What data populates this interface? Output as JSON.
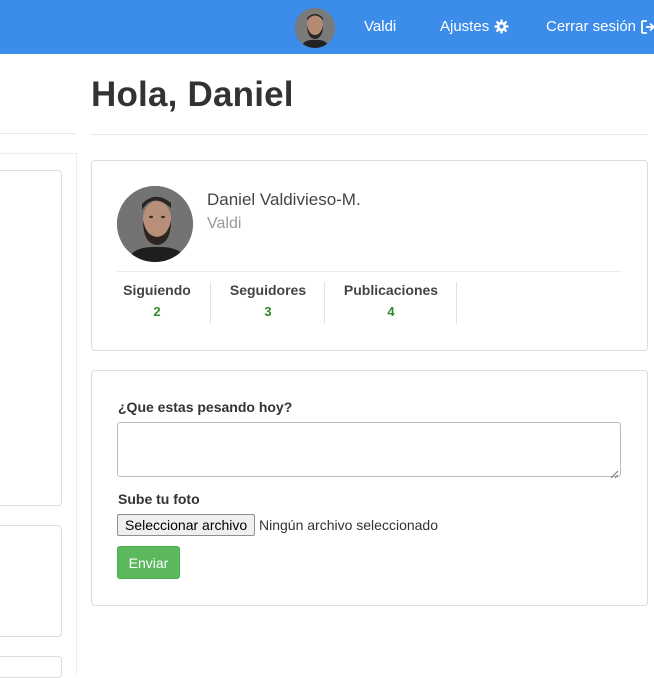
{
  "navbar": {
    "username": "Valdi",
    "settings_label": "Ajustes",
    "logout_label": "Cerrar sesión",
    "background": "#3c8cea",
    "icons": {
      "settings": "gear-icon",
      "logout": "sign-out-icon"
    }
  },
  "main": {
    "greeting": "Hola, Daniel"
  },
  "profile": {
    "full_name": "Daniel Valdivieso-M.",
    "username": "Valdi",
    "stats": [
      {
        "label": "Siguiendo",
        "value": "2"
      },
      {
        "label": "Seguidores",
        "value": "3"
      },
      {
        "label": "Publicaciones",
        "value": "4"
      }
    ],
    "stat_value_color": "#2e8b2e"
  },
  "post_form": {
    "question_label": "¿Que estas pesando hoy?",
    "textarea_value": "",
    "photo_label": "Sube tu foto",
    "file_button_label": "Seleccionar archivo",
    "file_status": "Ningún archivo seleccionado",
    "submit_label": "Enviar",
    "submit_color": "#5cb85c"
  }
}
